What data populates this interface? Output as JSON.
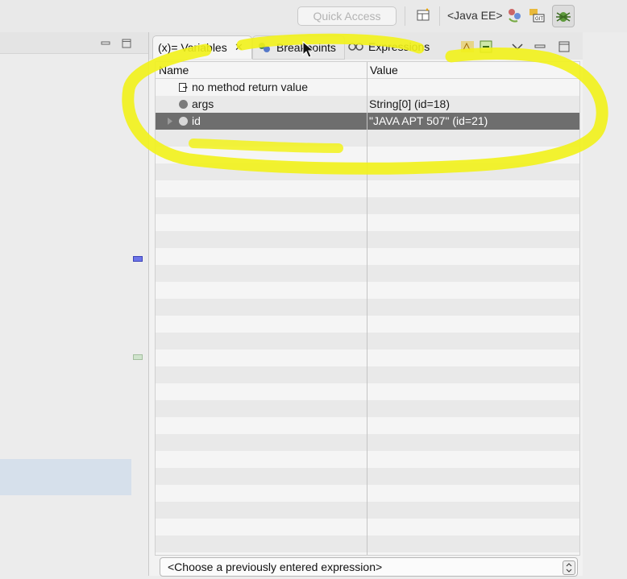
{
  "toolbar": {
    "quick_access_label": "Quick Access",
    "perspective_label": "<Java EE>",
    "icons": [
      "open-perspective-icon",
      "java-ee-icon",
      "team-sync-icon",
      "git-icon",
      "debug-perspective-icon"
    ]
  },
  "view": {
    "tabs": [
      {
        "label": "(x)= Variables",
        "icon": "variables-icon",
        "active": true,
        "close_glyph": "✕"
      },
      {
        "label": "Breakpoints",
        "icon": "breakpoints-icon",
        "active": false
      },
      {
        "label": "Expressions",
        "icon": "expressions-icon",
        "active": false
      }
    ],
    "toolbar_icons": [
      "show-type-names-icon",
      "collapse-all-icon",
      "view-menu-icon",
      "minimize-icon",
      "maximize-icon"
    ]
  },
  "variables": {
    "columns": [
      "Name",
      "Value"
    ],
    "rows": [
      {
        "name": "no method return value",
        "value": "",
        "icon": "return-value-icon",
        "selected": false
      },
      {
        "name": "args",
        "value": "String[0]  (id=18)",
        "icon": "local-variable-icon",
        "selected": false
      },
      {
        "name": "id",
        "value": "\"JAVA APT 507\" (id=21)",
        "icon": "local-variable-icon",
        "selected": true
      }
    ]
  },
  "expression_input": {
    "placeholder": "<Choose a previously entered expression>"
  },
  "colors": {
    "annotation": "#f2f21a",
    "selected_row": "#6e6e6e",
    "left_highlight": "#d6e0eb"
  }
}
